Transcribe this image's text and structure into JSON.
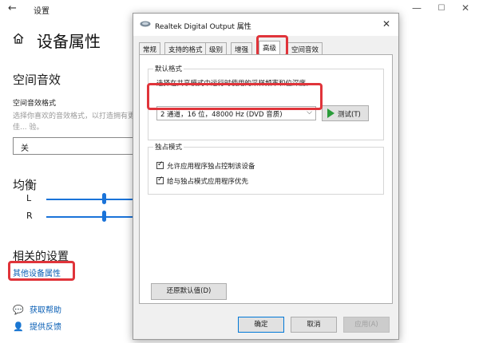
{
  "settings": {
    "window_title": "设置",
    "page_title": "设备属性",
    "spatial": {
      "heading": "空间音效",
      "format_label": "空间音效格式",
      "description": "选择你喜欢的音效格式，以打造拥有更佳... 验。",
      "selected": "关"
    },
    "balance": {
      "heading": "均衡",
      "left_label": "L",
      "right_label": "R",
      "left_level": 0.6,
      "right_level": 0.6
    },
    "related": {
      "heading": "相关的设置",
      "link": "其他设备属性"
    },
    "help": {
      "get_help": "获取帮助",
      "feedback": "提供反馈"
    }
  },
  "dialog": {
    "title": "Realtek Digital Output 属性",
    "tabs": [
      "常规",
      "支持的格式",
      "级别",
      "增强",
      "高级",
      "空间音效"
    ],
    "active_tab": "高级",
    "default_format": {
      "group_label": "默认格式",
      "description": "选择在共享模式中运行时使用的采样频率和位深度。",
      "selected_format": "2 通道，16 位，48000 Hz (DVD 音质)",
      "test_button": "测试(T)"
    },
    "exclusive": {
      "group_label": "独占模式",
      "option1": "允许应用程序独占控制该设备",
      "option1_checked": true,
      "option2": "给与独占模式应用程序优先",
      "option2_checked": true
    },
    "restore_button": "还原默认值(D)",
    "ok_button": "确定",
    "cancel_button": "取消",
    "apply_button": "应用(A)"
  },
  "colors": {
    "highlight": "#e0343a",
    "link": "#0a5fb5",
    "slider": "#1a73d9"
  }
}
